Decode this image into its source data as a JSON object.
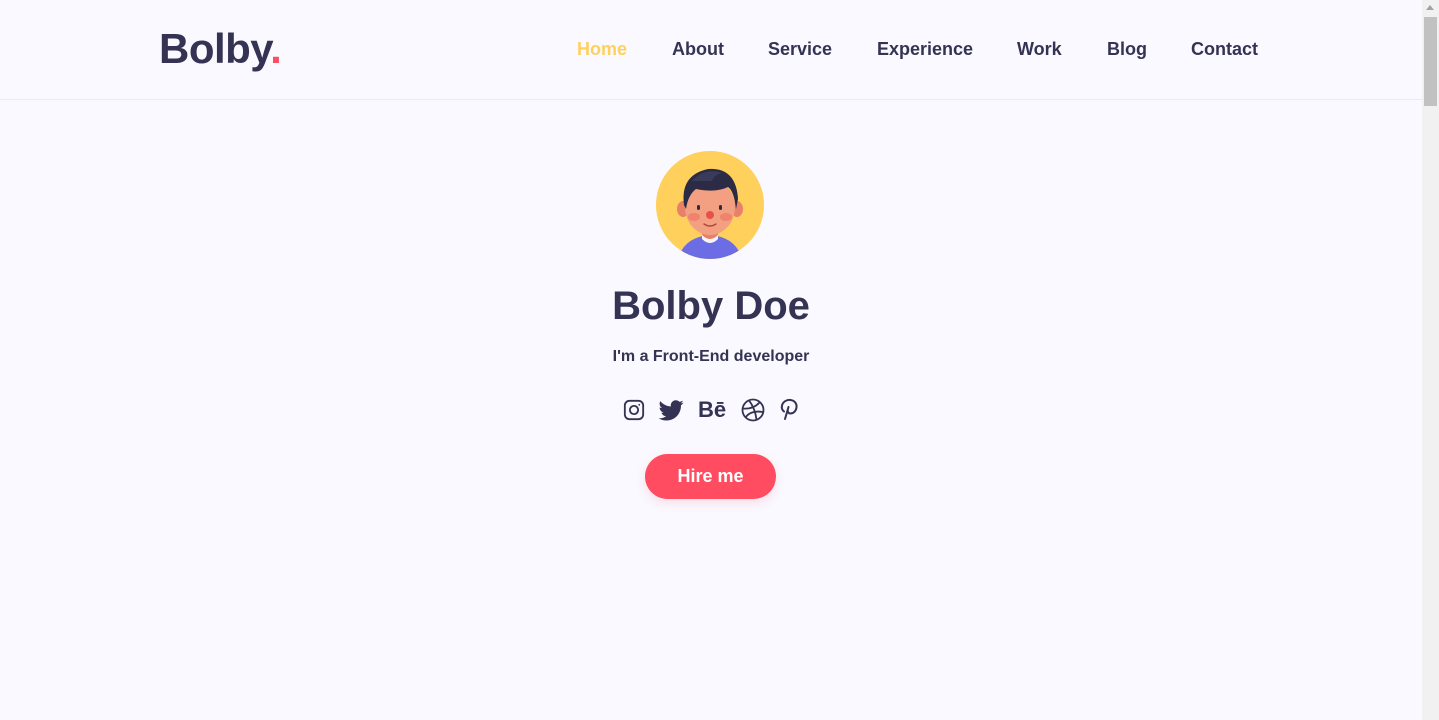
{
  "brand": {
    "name": "Bolby",
    "dot": "."
  },
  "nav": {
    "items": [
      {
        "label": "Home",
        "active": true
      },
      {
        "label": "About"
      },
      {
        "label": "Service"
      },
      {
        "label": "Experience"
      },
      {
        "label": "Work"
      },
      {
        "label": "Blog"
      },
      {
        "label": "Contact"
      }
    ]
  },
  "hero": {
    "avatar": "avatar-illustration",
    "name": "Bolby Doe",
    "tagline": "I'm a Front-End developer",
    "social": [
      {
        "icon": "instagram-icon"
      },
      {
        "icon": "twitter-icon"
      },
      {
        "icon": "behance-icon",
        "text": "Bē"
      },
      {
        "icon": "dribbble-icon"
      },
      {
        "icon": "pinterest-icon"
      }
    ],
    "cta_label": "Hire me"
  },
  "colors": {
    "text": "#353353",
    "accent_yellow": "#ffd15c",
    "accent_red": "#ff4c60",
    "background": "#f9f9ff"
  }
}
